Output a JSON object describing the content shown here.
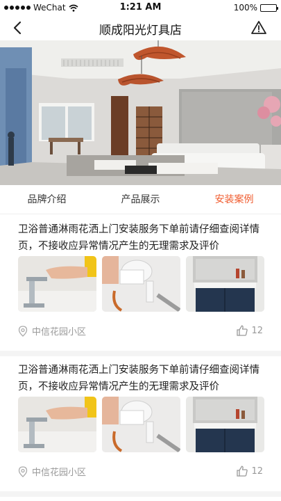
{
  "status_bar": {
    "carrier": "WeChat",
    "time": "1:21 AM",
    "battery": "100%",
    "battery_level": 1.0
  },
  "nav": {
    "title": "顺成阳光灯具店",
    "back_icon": "chevron-left-icon",
    "report_icon": "warning-triangle-icon"
  },
  "tabs": [
    {
      "label": "品牌介绍",
      "active": false
    },
    {
      "label": "产品展示",
      "active": false
    },
    {
      "label": "安装案例",
      "active": true
    }
  ],
  "accent_color": "#f05b2e",
  "posts": [
    {
      "text": "卫浴普通淋雨花洒上门安装服务下单前请仔细查阅详情页，不接收应异常情况产生的无理需求及评价",
      "location": "中信花园小区",
      "likes": "12"
    },
    {
      "text": "卫浴普通淋雨花洒上门安装服务下单前请仔细查阅详情页，不接收应异常情况产生的无理需求及评价",
      "location": "中信花园小区",
      "likes": "12"
    }
  ]
}
